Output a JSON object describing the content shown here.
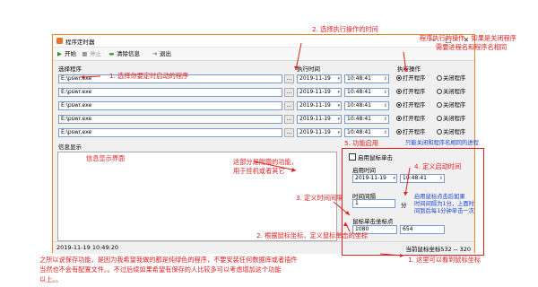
{
  "window": {
    "title": "程序定时器",
    "minimize": "—",
    "maximize": "□",
    "close": "✕"
  },
  "toolbar": {
    "start": "开始",
    "stop": "停止",
    "clear": "清除信息",
    "exit": "退出"
  },
  "headers": {
    "program": "选择程序",
    "exec_time": "执行时间",
    "exec_op": "执行操作"
  },
  "rows": [
    {
      "path": "E:\\pswr.exe",
      "browse": "...",
      "date": "2019-11-19",
      "time": "10:48:41",
      "open": "打开程序",
      "close": "关闭程序"
    },
    {
      "path": "E:\\pswr.exe",
      "browse": "...",
      "date": "2019-11-19",
      "time": "10:48:41",
      "open": "打开程序",
      "close": "关闭程序"
    },
    {
      "path": "E:\\pswr.exe",
      "browse": "...",
      "date": "2019-11-19",
      "time": "10:48:41",
      "open": "打开程序",
      "close": "关闭程序"
    },
    {
      "path": "E:\\pswr.exe",
      "browse": "...",
      "date": "2019-11-19",
      "time": "10:48:41",
      "open": "打开程序",
      "close": "关闭程序"
    },
    {
      "path": "E:\\pswr.exe",
      "browse": "...",
      "date": "2019-11-19",
      "time": "10:48:41",
      "open": "打开程序",
      "close": "关闭程序"
    }
  ],
  "info": {
    "label": "信息显示"
  },
  "mouse_panel": {
    "checkbox": "启用鼠标单击",
    "start_time_label": "启用时间",
    "date": "2019-11-19",
    "time": "10:48:41",
    "interval_label": "时间间隔",
    "interval_value": "1",
    "interval_unit": "分",
    "coords_label": "鼠标单击坐标点",
    "x": "1080",
    "y": "654"
  },
  "status": {
    "datetime": "2019-11-19 10:49:20",
    "mouse": "当前鼠标坐标532 -- 320"
  },
  "annotations": {
    "a1": "1. 选择你要定时启动的程序",
    "a2": "2. 选择执行操作的时间",
    "a3_l1": "程序执行的操作，如果是关闭程序",
    "a3_l2": "需要进程名和程序名相同",
    "a4": "只能关闭和程序名相同的进程",
    "a5": "5. 功能启用",
    "a6": "信息显示界面",
    "a7_l1": "这部分是附赠的功能，",
    "a7_l2": "用于挂机或者其它",
    "a8": "4. 定义启动时间",
    "a9": "3. 定义时间间隔",
    "a10_l1": "启用鼠标点击后如果",
    "a10_l2": "时间间隔为1分，上面时",
    "a10_l3": "间到后每1分钟单击一次",
    "a11": "2. 根据鼠标坐标，定义鼠标单击的坐标",
    "a12": "1. 这里可以看到鼠标坐标",
    "a13_l1": "之所以说保存功能，是因为我希望我做的都是纯绿色的程序，不要安装任何数据库或者插件",
    "a13_l2": "当然也不会有配置文件。。不过后续如果希望有保存的人比较多可以考虑增加这个功能",
    "a13_l3": "以上。。"
  },
  "colors": {
    "accent": "#e08a2a",
    "annotation_red": "#e02020",
    "annotation_blue": "#1a3fd0",
    "field_border": "#7a9cc9"
  }
}
